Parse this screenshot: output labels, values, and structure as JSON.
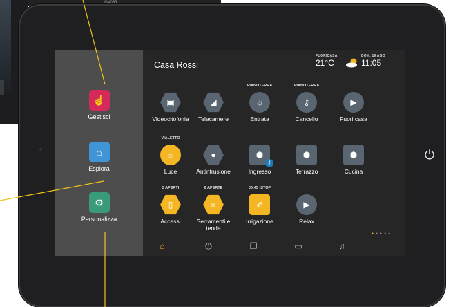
{
  "background": {
    "screen_label": "@a063"
  },
  "sidebar": {
    "items": [
      {
        "label": "Gestisci",
        "icon": "touch-hand-icon",
        "color": "#d4295a"
      },
      {
        "label": "Esplora",
        "icon": "home-icon",
        "color": "#3f95d6"
      },
      {
        "label": "Personalizza",
        "icon": "gear-icon",
        "color": "#3a9b7b"
      }
    ]
  },
  "header": {
    "title": "Casa Rossi",
    "status_label": "FUORICASA",
    "temperature": "21°C",
    "date": "DOM. 19 AGO",
    "time": "11:05"
  },
  "tiles": {
    "row1": [
      {
        "top": "",
        "label": "Videocitofonia",
        "icon": "intercom-icon"
      },
      {
        "top": "",
        "label": "Telecamere",
        "icon": "camera-icon"
      },
      {
        "top": "PIANOTERRA",
        "label": "Entrata",
        "icon": "light-bulb-icon"
      },
      {
        "top": "PIANOTERRA",
        "label": "Cancello",
        "icon": "key-icon"
      },
      {
        "top": "",
        "label": "Fuori casa",
        "icon": "play-icon"
      }
    ],
    "row2": [
      {
        "top": "VIALETTO",
        "label": "Luce",
        "icon": "light-bulb-icon"
      },
      {
        "top": "",
        "label": "Antintrusione",
        "icon": "guard-icon"
      },
      {
        "top": "",
        "label": "Ingresso",
        "icon": "cube-icon"
      },
      {
        "top": "",
        "label": "Terrazzo",
        "icon": "cube-icon"
      },
      {
        "top": "",
        "label": "Cucina",
        "icon": "cube-icon"
      }
    ],
    "row3": [
      {
        "top": "3 APERTI",
        "label": "Accessi",
        "icon": "door-icon"
      },
      {
        "top": "6 APERTE",
        "label": "Serramenti e tende",
        "icon": "shutter-icon"
      },
      {
        "top": "00:45 -STOP",
        "label": "Irrigazione",
        "icon": "sprinkler-icon"
      },
      {
        "top": "",
        "label": "Relax",
        "icon": "play-icon"
      }
    ]
  },
  "bottom_nav": [
    "home-icon",
    "power-icon",
    "copy-icon",
    "message-icon",
    "bell-icon"
  ],
  "colors": {
    "accent": "#f4b622",
    "tile": "#596570",
    "sidebar": "#4d4d4d",
    "screen": "#262626"
  }
}
